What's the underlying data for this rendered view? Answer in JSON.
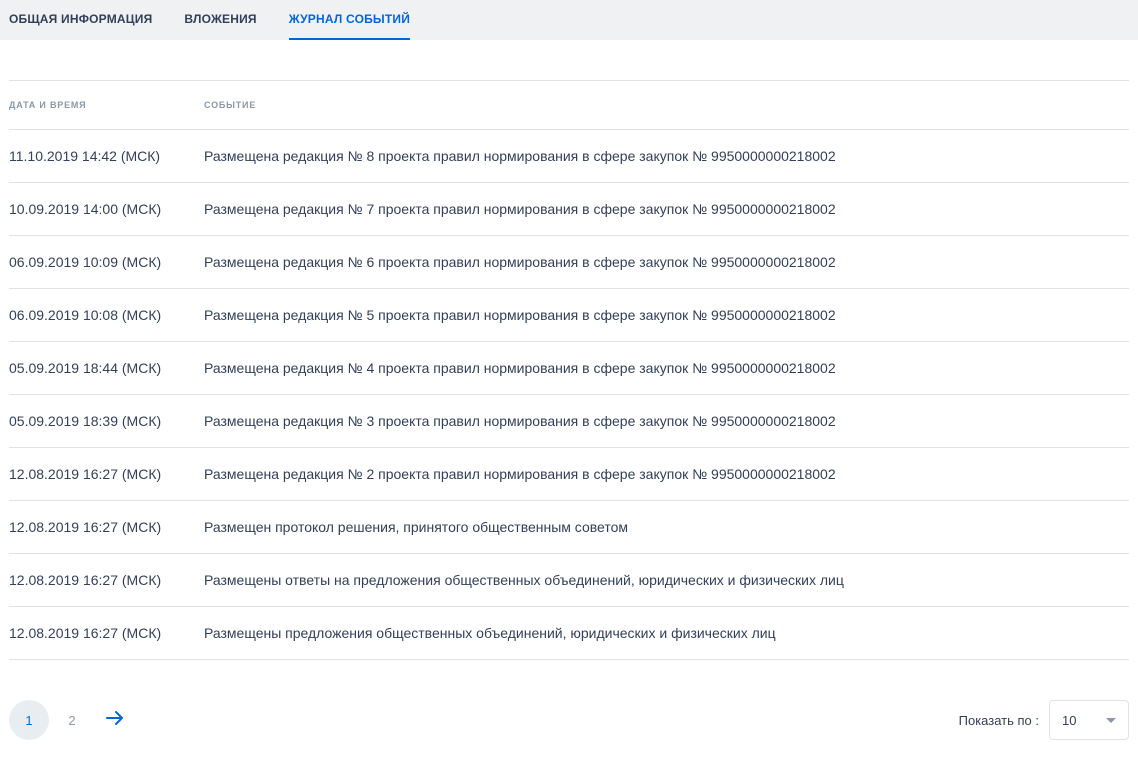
{
  "tabs": [
    {
      "label": "ОБЩАЯ ИНФОРМАЦИЯ"
    },
    {
      "label": "ВЛОЖЕНИЯ"
    },
    {
      "label": "ЖУРНАЛ СОБЫТИЙ"
    }
  ],
  "active_tab": 2,
  "table": {
    "headers": {
      "datetime": "ДАТА И ВРЕМЯ",
      "event": "СОБЫТИЕ"
    },
    "rows": [
      {
        "datetime": "11.10.2019 14:42 (МСК)",
        "event": "Размещена редакция № 8 проекта правил нормирования в сфере закупок № 9950000000218002"
      },
      {
        "datetime": "10.09.2019 14:00 (МСК)",
        "event": "Размещена редакция № 7 проекта правил нормирования в сфере закупок № 9950000000218002"
      },
      {
        "datetime": "06.09.2019 10:09 (МСК)",
        "event": "Размещена редакция № 6 проекта правил нормирования в сфере закупок № 9950000000218002"
      },
      {
        "datetime": "06.09.2019 10:08 (МСК)",
        "event": "Размещена редакция № 5 проекта правил нормирования в сфере закупок № 9950000000218002"
      },
      {
        "datetime": "05.09.2019 18:44 (МСК)",
        "event": "Размещена редакция № 4 проекта правил нормирования в сфере закупок № 9950000000218002"
      },
      {
        "datetime": "05.09.2019 18:39 (МСК)",
        "event": "Размещена редакция № 3 проекта правил нормирования в сфере закупок № 9950000000218002"
      },
      {
        "datetime": "12.08.2019 16:27 (МСК)",
        "event": "Размещена редакция № 2 проекта правил нормирования в сфере закупок № 9950000000218002"
      },
      {
        "datetime": "12.08.2019 16:27 (МСК)",
        "event": "Размещен протокол решения, принятого общественным советом"
      },
      {
        "datetime": "12.08.2019 16:27 (МСК)",
        "event": "Размещены ответы на предложения общественных объединений, юридических и физических лиц"
      },
      {
        "datetime": "12.08.2019 16:27 (МСК)",
        "event": "Размещены предложения общественных объединений, юридических и физических лиц"
      }
    ]
  },
  "pagination": {
    "pages": [
      "1",
      "2"
    ],
    "current": "1",
    "next_icon": "arrow-right-icon",
    "show_label": "Показать по :",
    "page_size": "10"
  },
  "colors": {
    "accent": "#0065dd",
    "text": "#334059",
    "muted": "#8b98a7",
    "tab_bar": "#eff1f3",
    "divider": "#dfe3e8"
  }
}
